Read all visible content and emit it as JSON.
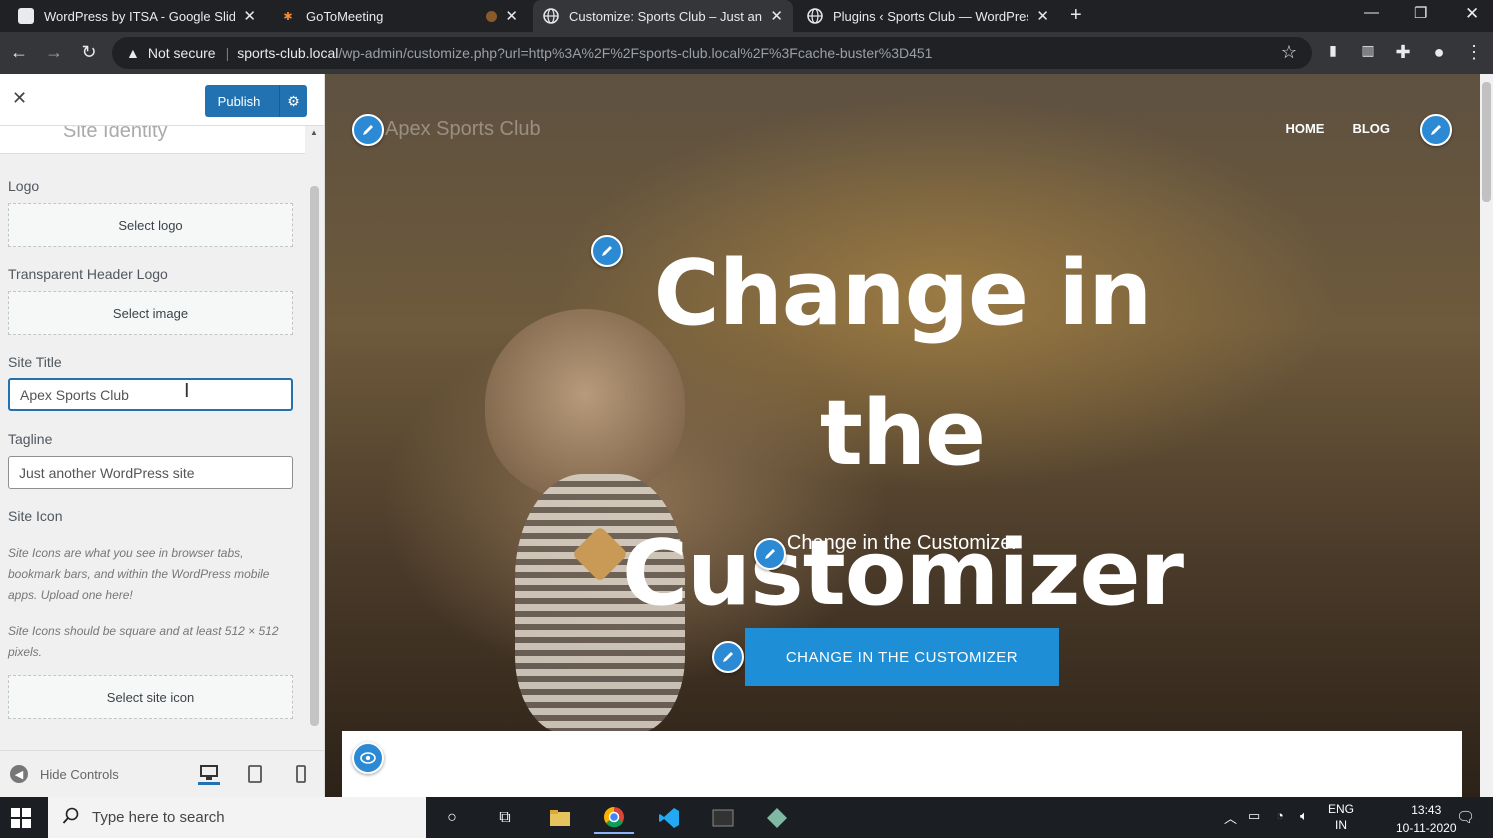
{
  "browser": {
    "tabs": [
      {
        "title": "WordPress by ITSA - Google Slides",
        "favicon_color": "#e8eaed"
      },
      {
        "title": "GoToMeeting",
        "favicon_color": "#f28b30"
      },
      {
        "title": "Customize: Sports Club – Just another WordPress site",
        "favicon_color": "#e8eaed"
      },
      {
        "title": "Plugins ‹ Sports Club — WordPress",
        "favicon_color": "#e8eaed"
      }
    ],
    "new_tab": "+",
    "address": {
      "security": "Not secure",
      "host": "sports-club.local",
      "path": "/wp-admin/customize.php?url=http%3A%2F%2Fsports-club.local%2F%3Fcache-buster%3D451"
    }
  },
  "customizer": {
    "publish_label": "Publish",
    "section_title": "Site Identity",
    "logo": {
      "label": "Logo",
      "button": "Select logo"
    },
    "transparent_logo": {
      "label": "Transparent Header Logo",
      "button": "Select image"
    },
    "site_title": {
      "label": "Site Title",
      "value": "Apex Sports Club"
    },
    "tagline": {
      "label": "Tagline",
      "value": "Just another WordPress site"
    },
    "site_icon": {
      "label": "Site Icon",
      "desc1": "Site Icons are what you see in browser tabs, bookmark bars, and within the WordPress mobile apps. Upload one here!",
      "desc2": "Site Icons should be square and at least 512 × 512 pixels.",
      "button": "Select site icon"
    },
    "hide_controls": "Hide Controls"
  },
  "preview": {
    "site_name": "Apex Sports Club",
    "nav": [
      "HOME",
      "BLOG"
    ],
    "hero_title": "Change in the Customizer",
    "hero_subtitle": "Change in the Customizer",
    "hero_button": "CHANGE IN THE CUSTOMIZER"
  },
  "taskbar": {
    "search_placeholder": "Type here to search",
    "language": "ENG",
    "region": "IN",
    "time": "13:43",
    "date": "10-11-2020"
  },
  "colors": {
    "accent": "#2271b1",
    "pencil": "#2b8ad3",
    "cta": "#1e8fd6"
  }
}
